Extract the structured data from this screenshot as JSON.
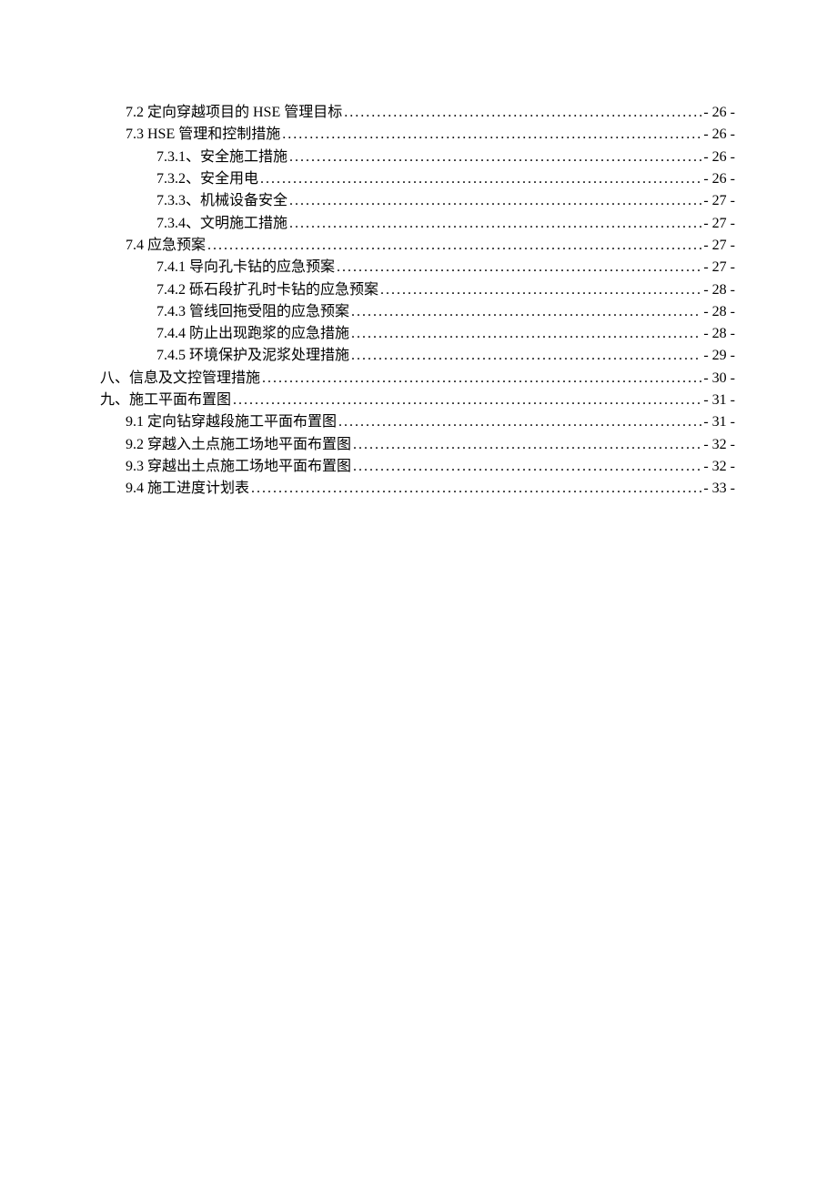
{
  "toc": [
    {
      "indent": 1,
      "label": "7.2 定向穿越项目的 HSE 管理目标",
      "page": "- 26 -"
    },
    {
      "indent": 1,
      "label": "7.3 HSE 管理和控制措施",
      "page": "- 26 -"
    },
    {
      "indent": 2,
      "label": "7.3.1、安全施工措施",
      "page": "- 26 -"
    },
    {
      "indent": 2,
      "label": "7.3.2、安全用电",
      "page": "- 26 -"
    },
    {
      "indent": 2,
      "label": "7.3.3、机械设备安全",
      "page": "- 27 -"
    },
    {
      "indent": 2,
      "label": "7.3.4、文明施工措施",
      "page": "- 27 -"
    },
    {
      "indent": 1,
      "label": "7.4 应急预案",
      "page": "- 27 -"
    },
    {
      "indent": 2,
      "label": "7.4.1 导向孔卡钻的应急预案",
      "page": "- 27 -"
    },
    {
      "indent": 2,
      "label": "7.4.2 砾石段扩孔时卡钻的应急预案",
      "page": "- 28 -"
    },
    {
      "indent": 2,
      "label": "7.4.3 管线回拖受阻的应急预案",
      "page": "- 28 -"
    },
    {
      "indent": 2,
      "label": "7.4.4 防止出现跑浆的应急措施",
      "page": "- 28 -"
    },
    {
      "indent": 2,
      "label": "7.4.5 环境保护及泥浆处理措施",
      "page": "- 29 -"
    },
    {
      "indent": 0,
      "label": "八、信息及文控管理措施",
      "page": "- 30 -"
    },
    {
      "indent": 0,
      "label": "九、施工平面布置图",
      "page": "- 31 -"
    },
    {
      "indent": 1,
      "label": "9.1 定向钻穿越段施工平面布置图",
      "page": "- 31 -"
    },
    {
      "indent": 1,
      "label": "9.2 穿越入土点施工场地平面布置图",
      "page": "- 32 -"
    },
    {
      "indent": 1,
      "label": "9.3 穿越出土点施工场地平面布置图",
      "page": "- 32 -"
    },
    {
      "indent": 1,
      "label": "9.4 施工进度计划表",
      "page": "- 33 -"
    }
  ]
}
